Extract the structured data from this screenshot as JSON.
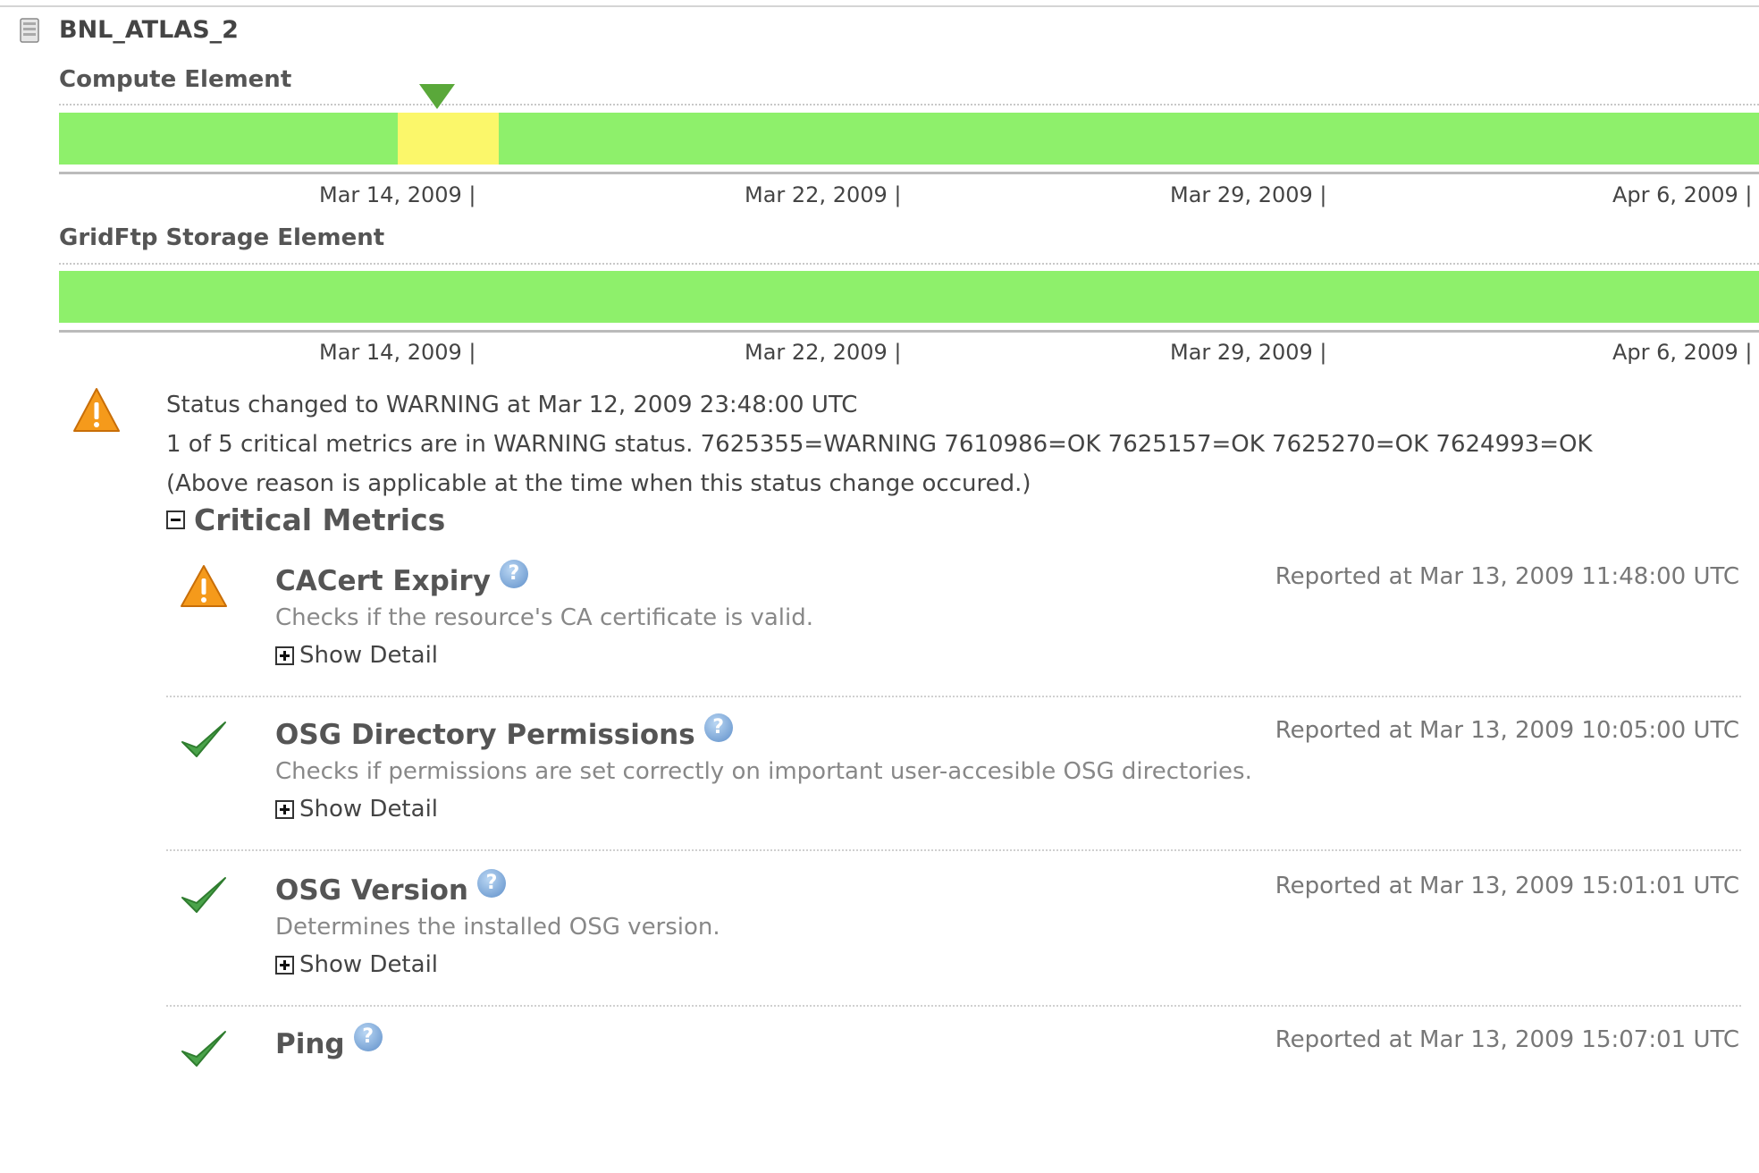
{
  "site": {
    "name": "BNL_ATLAS_2",
    "icon": "server-icon"
  },
  "timelines": [
    {
      "title": "Compute Element",
      "segments": [
        {
          "status": "OK",
          "color": "#8ef06b",
          "start_fraction": 0.0,
          "end_fraction": 0.1994
        },
        {
          "status": "WARNING",
          "color": "#fbf76a",
          "start_fraction": 0.1994,
          "end_fraction": 0.2589
        },
        {
          "status": "OK",
          "color": "#8ef06b",
          "start_fraction": 0.2589,
          "end_fraction": 1.0
        }
      ],
      "marker": {
        "icon": "triangle-down-icon",
        "color": "#5aa83a",
        "position_fraction": 0.2224
      },
      "ticks": [
        "Mar 14, 2009 |",
        "Mar 22, 2009 |",
        "Mar 29, 2009 |",
        "Apr 6, 2009 |"
      ]
    },
    {
      "title": "GridFtp Storage Element",
      "segments": [
        {
          "status": "OK",
          "color": "#8ef06b",
          "start_fraction": 0.0,
          "end_fraction": 1.0
        }
      ],
      "ticks": [
        "Mar 14, 2009 |",
        "Mar 22, 2009 |",
        "Mar 29, 2009 |",
        "Apr 6, 2009 |"
      ]
    }
  ],
  "status": {
    "icon": "warning-icon",
    "changed": "Status changed to WARNING at Mar 12, 2009 23:48:00 UTC",
    "reason": "1 of 5 critical metrics are in WARNING status. 7625355=WARNING 7610986=OK 7625157=OK 7625270=OK 7624993=OK",
    "note": "(Above reason is applicable at the time when this status change occured.)"
  },
  "critical_metrics": {
    "heading": "Critical Metrics",
    "toggle_icon": "collapse-icon",
    "items": [
      {
        "status": "WARNING",
        "icon": "warning-icon",
        "name": "CACert Expiry",
        "description": "Checks if the resource's CA certificate is valid.",
        "reported": "Reported at Mar 13, 2009 11:48:00 UTC",
        "detail_label": "Show Detail"
      },
      {
        "status": "OK",
        "icon": "checkmark-icon",
        "name": "OSG Directory Permissions",
        "description": "Checks if permissions are set correctly on important user-accesible OSG directories.",
        "reported": "Reported at Mar 13, 2009 10:05:00 UTC",
        "detail_label": "Show Detail"
      },
      {
        "status": "OK",
        "icon": "checkmark-icon",
        "name": "OSG Version",
        "description": "Determines the installed OSG version.",
        "reported": "Reported at Mar 13, 2009 15:01:01 UTC",
        "detail_label": "Show Detail"
      },
      {
        "status": "OK",
        "icon": "checkmark-icon",
        "name": "Ping",
        "description": "",
        "reported": "Reported at Mar 13, 2009 15:07:01 UTC",
        "detail_label": ""
      }
    ]
  },
  "help_glyph": "?",
  "colors": {
    "ok": "#8ef06b",
    "warning": "#fbf76a",
    "warning_icon": "#f59a1b",
    "check": "#4aa34a",
    "help": "#5f8fc9"
  }
}
